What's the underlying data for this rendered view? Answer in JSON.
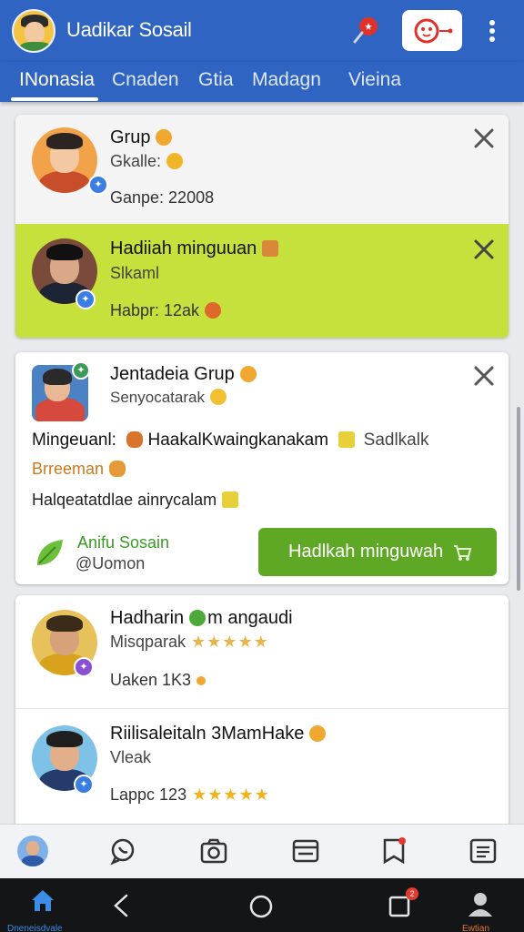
{
  "header": {
    "title": "Uadikar Sosail",
    "tabs": [
      {
        "label": "INonasia",
        "active": true
      },
      {
        "label": "Cnaden",
        "active": false
      },
      {
        "label": "Gtia",
        "active": false
      },
      {
        "label": "Madagn",
        "active": false
      },
      {
        "label": "Vieina",
        "active": false
      }
    ],
    "icons": [
      "avatar-logo",
      "pin-icon",
      "notification-badge-icon",
      "more-vert-icon"
    ]
  },
  "card1": {
    "rows": [
      {
        "title": "Grup",
        "sub": "Gkalle:",
        "meta": "Ganpe: 22008",
        "highlight": false
      },
      {
        "title": "Hadiiah minguuan",
        "sub": "Slkaml",
        "meta": "Habpr: 12ak",
        "highlight": true
      }
    ]
  },
  "card2": {
    "title": "Jentadeia Grup",
    "sub": "Senyocatarak",
    "line1_bold": "Mingeuanl:",
    "line1_text": "HaakalKwaingkanakam",
    "line1_tail": "Sadlkalk",
    "line2": "Brreeman",
    "line3": "Halqeatatdlae ainrycalam",
    "footer_name": "Anifu Sosain",
    "footer_handle": "@Uomon",
    "cta_label": "Hadlkah minguwah"
  },
  "card3": {
    "rows": [
      {
        "title": "Hadharin",
        "title_tail": "m angaudi",
        "sub": "Misqparak",
        "meta": "Uaken 1K3"
      },
      {
        "title": "Riilisaleitaln 3MamHake",
        "sub": "Vleak",
        "meta": "Lappc 123"
      }
    ]
  },
  "bottom_nav": [
    "profile-tab",
    "chat-tab",
    "camera-tab",
    "wallet-tab",
    "notes-tab",
    "list-tab"
  ],
  "system_bar": {
    "home_label": "Dneneisdvale",
    "profile_label": "Ewtian",
    "notif_count": "2"
  },
  "colors": {
    "primary": "#2f64c2",
    "highlight": "#c6e03c",
    "cta": "#5fa825",
    "accent_green": "#3b9a27"
  }
}
